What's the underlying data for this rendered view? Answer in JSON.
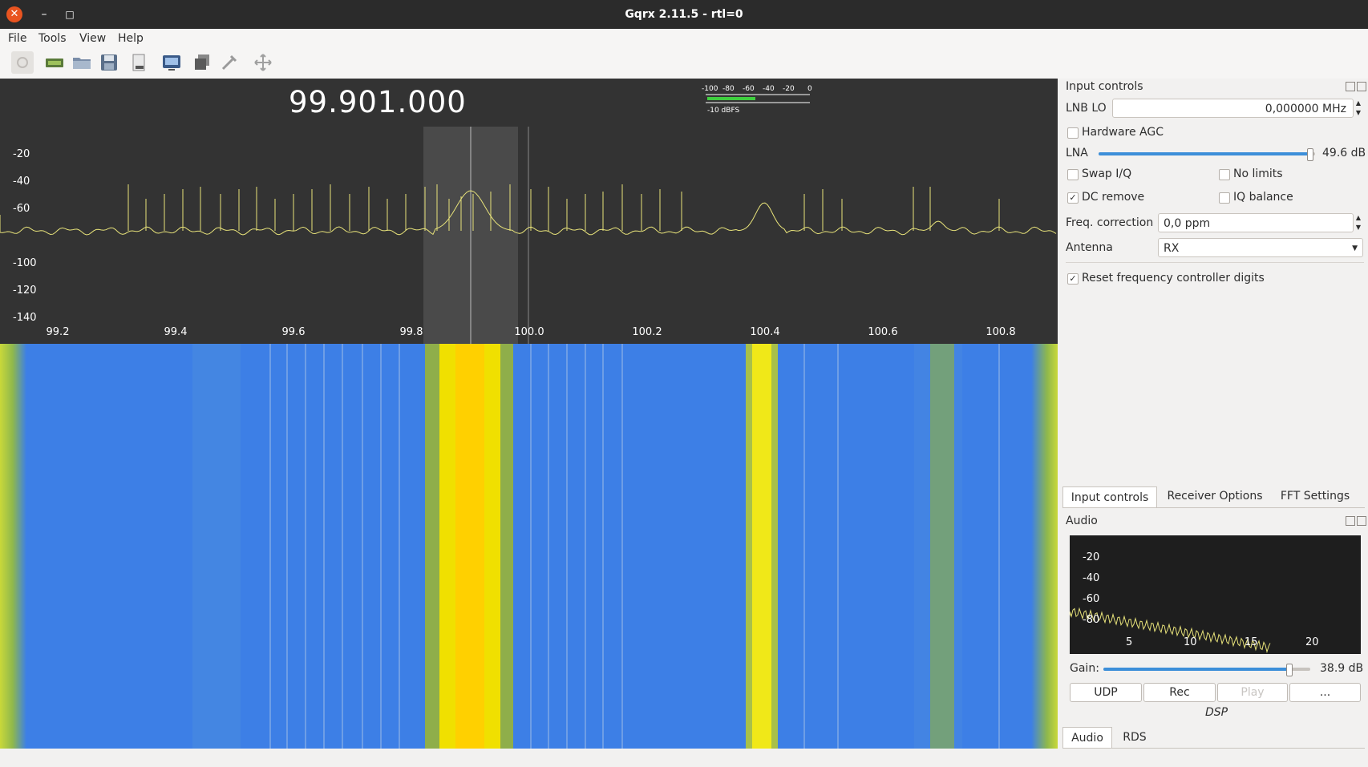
{
  "window": {
    "title": "Gqrx 2.11.5 - rtl=0",
    "close_glyph": "✕",
    "minimize_glyph": "–",
    "maximize_glyph": "□"
  },
  "menu": [
    "File",
    "Tools",
    "View",
    "Help"
  ],
  "toolbar_icons": [
    "power-icon",
    "hardware-icon",
    "open-icon",
    "save-icon",
    "export-icon",
    "remote-control-icon",
    "screenshot-icon",
    "tools-icon",
    "fullscreen-icon"
  ],
  "spectrum": {
    "frequency_display": "99.901.000",
    "meter_ticks": [
      "-100",
      "-80",
      "-60",
      "-40",
      "-20",
      "0"
    ],
    "meter_label": "-10 dBFS",
    "y_ticks": [
      "-20",
      "-40",
      "-60",
      "-100",
      "-120",
      "-140"
    ],
    "x_ticks": [
      "99.2",
      "99.4",
      "99.6",
      "99.8",
      "100.0",
      "100.2",
      "100.4",
      "100.6",
      "100.8"
    ]
  },
  "input_controls": {
    "title": "Input controls",
    "lnb_lo_label": "LNB LO",
    "lnb_lo_value": "0,000000 MHz",
    "hardware_agc_label": "Hardware AGC",
    "hardware_agc_checked": false,
    "lna_label": "LNA",
    "lna_value": "49.6 dB",
    "lna_level": 0.99,
    "swap_iq_label": "Swap I/Q",
    "no_limits_label": "No limits",
    "dc_remove_label": "DC remove",
    "dc_remove_checked": true,
    "iq_balance_label": "IQ balance",
    "freq_correction_label": "Freq. correction",
    "freq_correction_value": "0,0 ppm",
    "antenna_label": "Antenna",
    "antenna_value": "RX",
    "reset_freq_label": "Reset frequency controller digits",
    "reset_freq_checked": true
  },
  "tabs": [
    "Input controls",
    "Receiver Options",
    "FFT Settings"
  ],
  "audio": {
    "title": "Audio",
    "y_ticks": [
      "-20",
      "-40",
      "-60",
      "-80"
    ],
    "x_ticks": [
      "5",
      "10",
      "15",
      "20"
    ],
    "gain_label": "Gain:",
    "gain_value": "38.9 dB",
    "gain_level": 0.9,
    "buttons": [
      "UDP",
      "Rec",
      "Play",
      "..."
    ],
    "dsp_label": "DSP"
  },
  "bottom_tabs": [
    "Audio",
    "RDS"
  ],
  "colors": {
    "titlebar": "#2b2b2b",
    "close": "#e95420",
    "plot_bg": "#333333",
    "trace": "#e8e37a",
    "waterfall_bg": "#3d7fe6",
    "waterfall_hot": "#ffe000",
    "accent": "#3d8fd9"
  }
}
